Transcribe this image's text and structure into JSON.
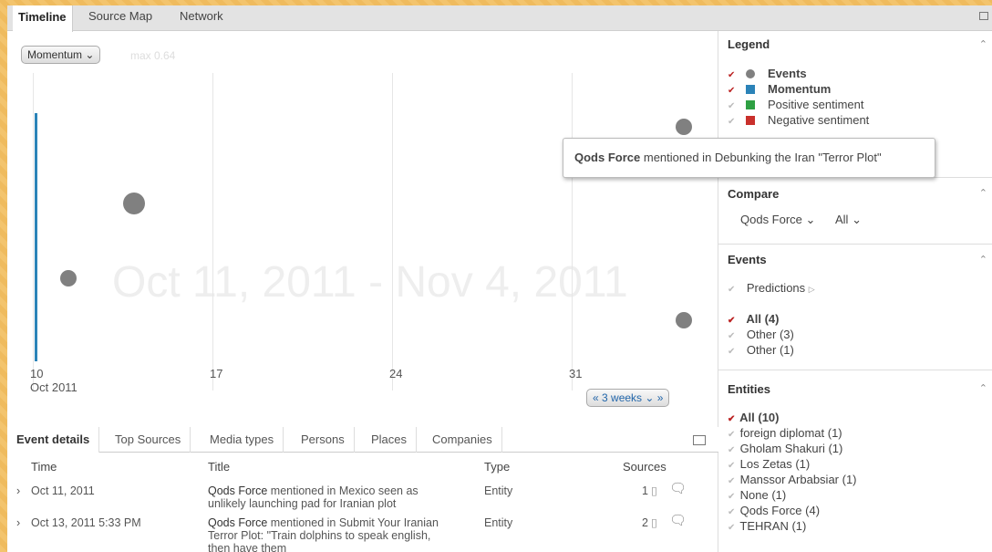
{
  "tabs": [
    "Timeline",
    "Source Map",
    "Network"
  ],
  "chart": {
    "metric": "Momentum",
    "max_label": "max 0.64",
    "range_label": "Oct 11, 2011 - Nov 4, 2011",
    "zoom": "3 weeks",
    "ticks": [
      {
        "day": "10",
        "sub": "Oct 2011"
      },
      {
        "day": "17",
        "sub": ""
      },
      {
        "day": "24",
        "sub": ""
      },
      {
        "day": "31",
        "sub": ""
      }
    ]
  },
  "tooltip": {
    "entity": "Qods Force",
    "text": " mentioned in Debunking the Iran \"Terror Plot\""
  },
  "legend": {
    "title": "Legend",
    "items": [
      {
        "label": "Events",
        "checked": true,
        "bold": true,
        "color": "#808080",
        "shape": "circle"
      },
      {
        "label": "Momentum",
        "checked": true,
        "bold": true,
        "color": "#2b83b8",
        "shape": "square"
      },
      {
        "label": "Positive sentiment",
        "checked": false,
        "bold": false,
        "color": "#2ea043",
        "shape": "square"
      },
      {
        "label": "Negative sentiment",
        "checked": false,
        "bold": false,
        "color": "#c9302c",
        "shape": "square"
      }
    ]
  },
  "compare": {
    "title": "Compare",
    "entity": "Qods Force",
    "filter": "All"
  },
  "events": {
    "title": "Events",
    "predictions": "Predictions",
    "items": [
      {
        "label": "All (4)",
        "checked": true
      },
      {
        "label": "Other (3)",
        "checked": false
      },
      {
        "label": "Other (1)",
        "checked": false
      }
    ]
  },
  "entities": {
    "title": "Entities",
    "items": [
      {
        "label": "All (10)",
        "checked": true
      },
      {
        "label": "foreign diplomat (1)",
        "checked": false
      },
      {
        "label": "Gholam Shakuri (1)",
        "checked": false
      },
      {
        "label": "Los Zetas (1)",
        "checked": false
      },
      {
        "label": "Manssor Arbabsiar (1)",
        "checked": false
      },
      {
        "label": "None (1)",
        "checked": false
      },
      {
        "label": "Qods Force (4)",
        "checked": false
      },
      {
        "label": "TEHRAN (1)",
        "checked": false
      }
    ]
  },
  "bottom_tabs": [
    "Event details",
    "Top Sources",
    "Media types",
    "Persons",
    "Places",
    "Companies"
  ],
  "table": {
    "headers": [
      "Time",
      "Title",
      "Type",
      "Sources"
    ],
    "rows": [
      {
        "time": "Oct 11, 2011",
        "entity": "Qods Force",
        "title_rest": " mentioned in Mexico seen as",
        "title_line2": "unlikely launching pad for Iranian plot",
        "title_line3": "",
        "type": "Entity",
        "sources": "1"
      },
      {
        "time": "Oct 13, 2011 5:33 PM",
        "entity": "Qods Force",
        "title_rest": " mentioned in Submit Your Iranian",
        "title_line2": "Terror Plot: \"Train dolphins to speak english,",
        "title_line3": "then have them",
        "type": "Entity",
        "sources": "2"
      }
    ]
  }
}
